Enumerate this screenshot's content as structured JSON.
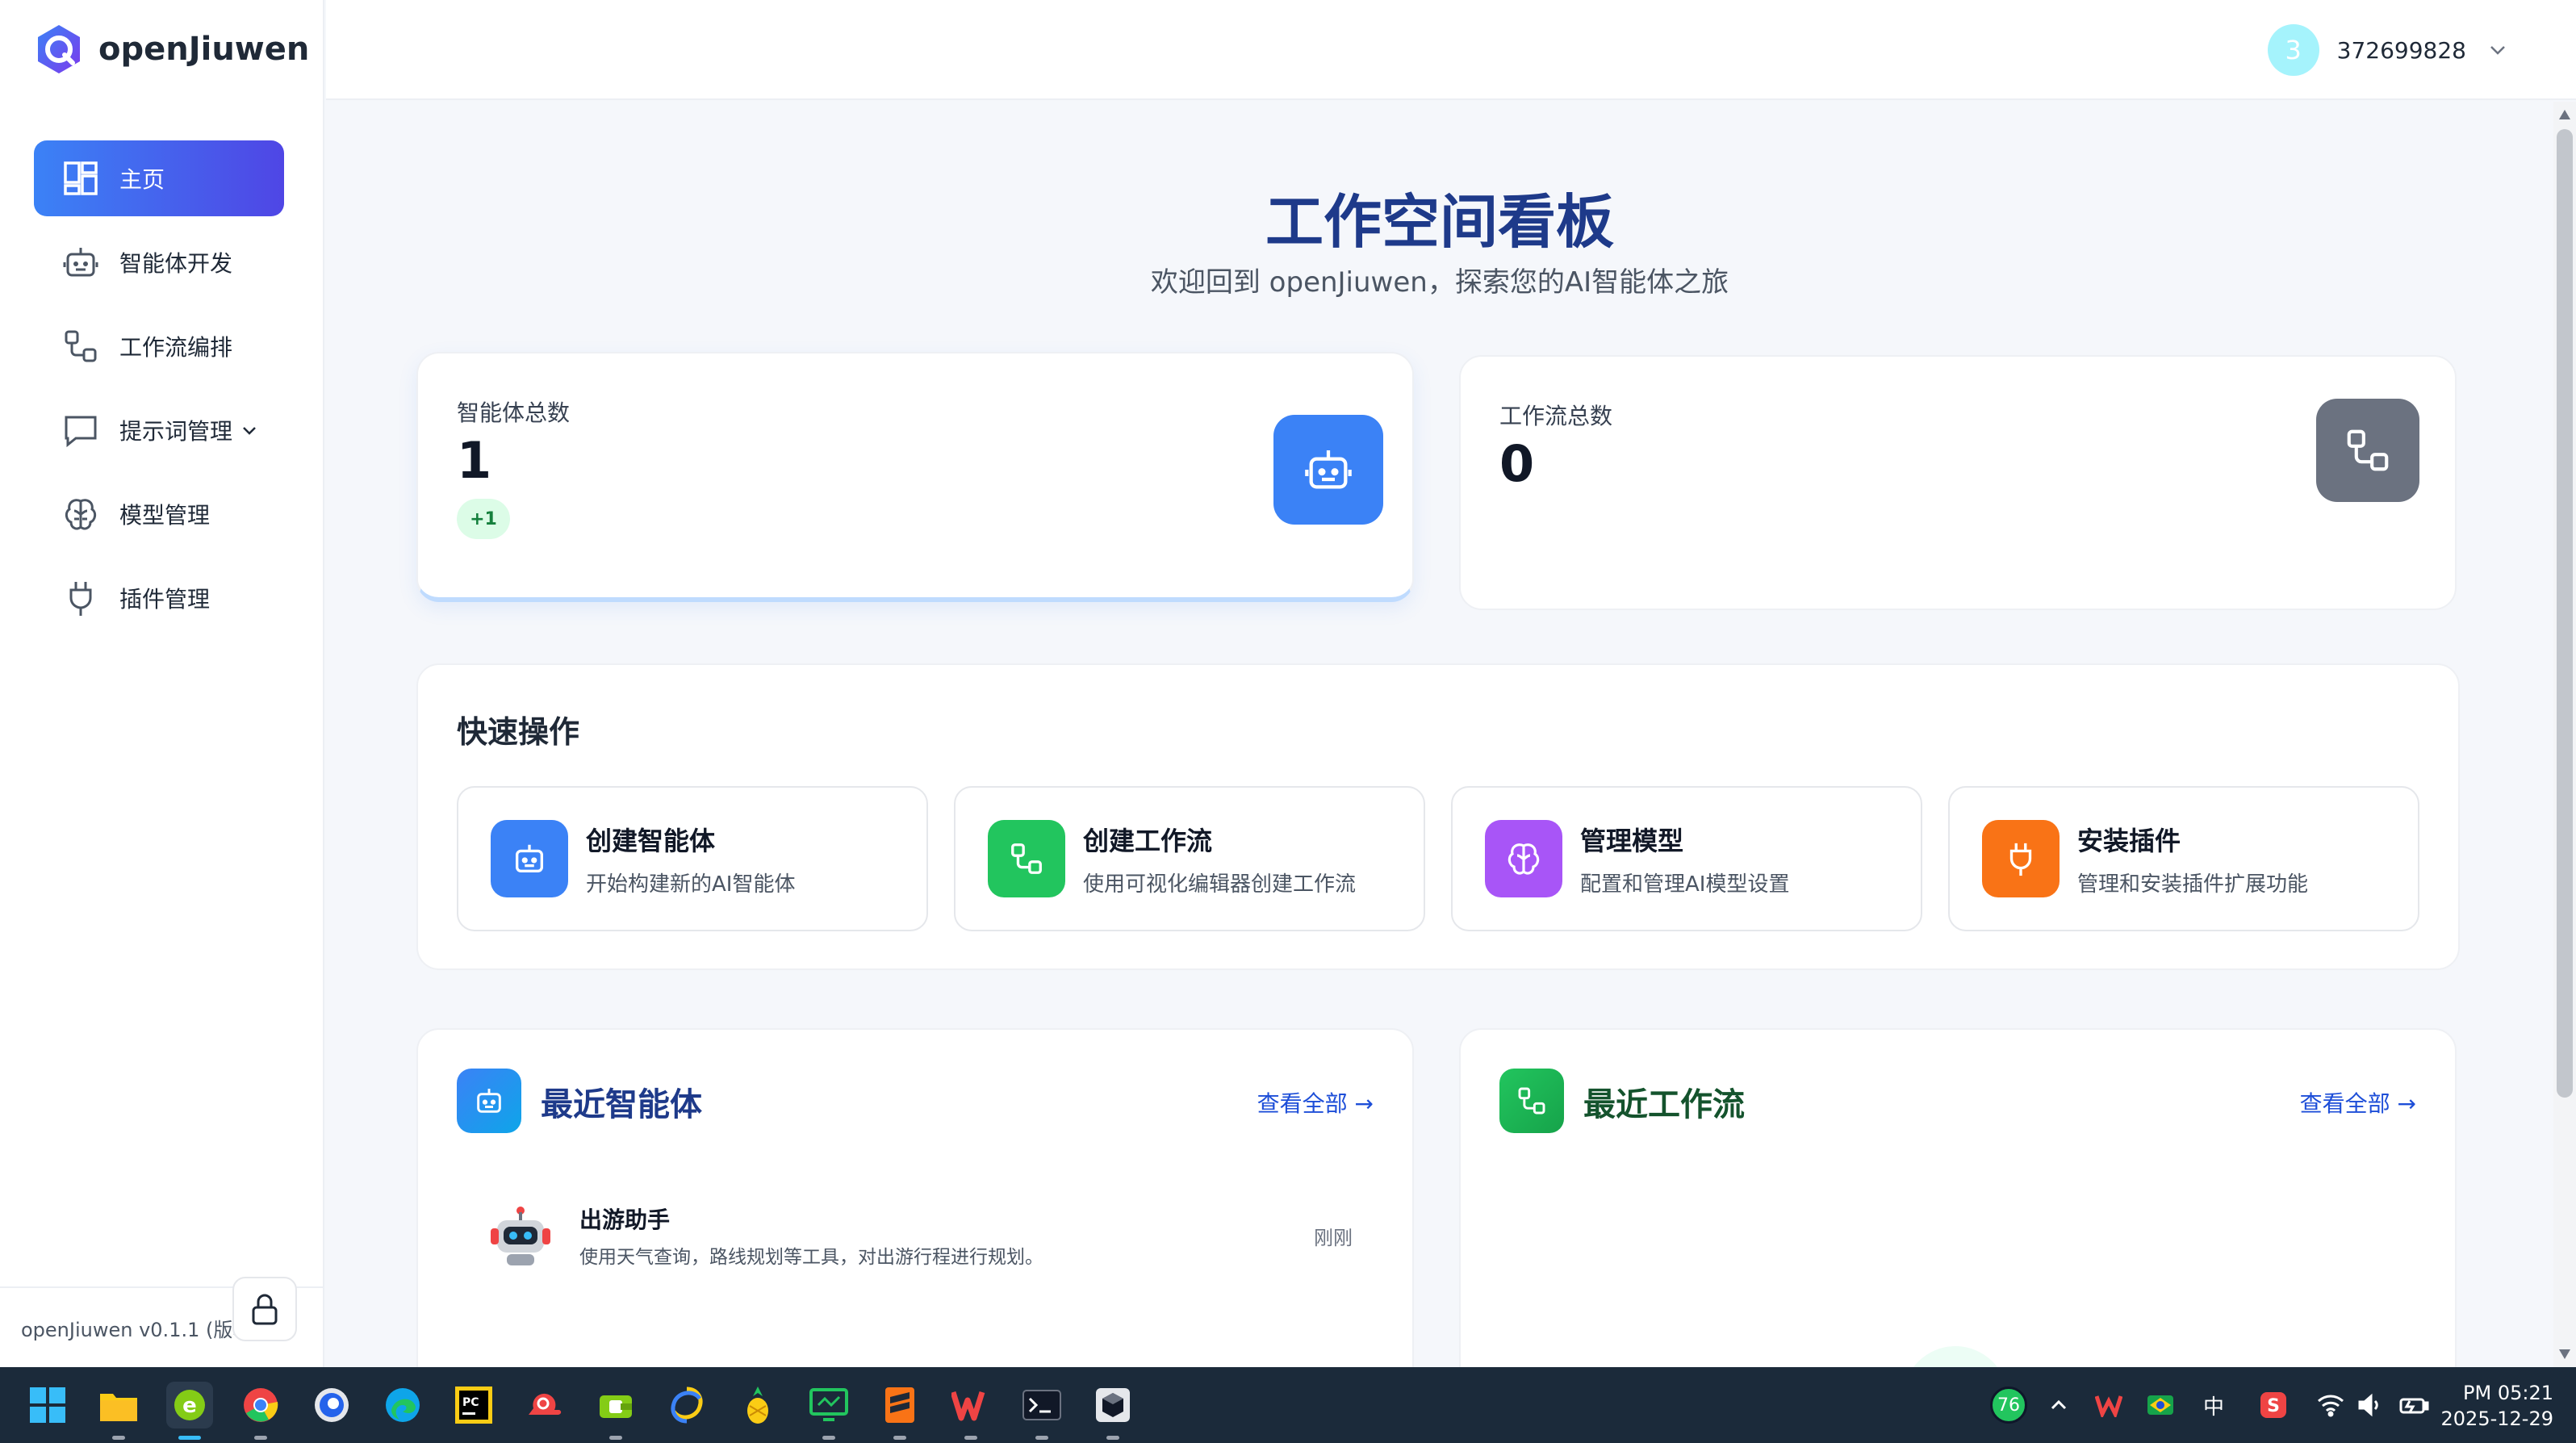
{
  "brand": {
    "name": "openJiuwen"
  },
  "nav": [
    {
      "label": "主页",
      "icon": "dashboard-icon",
      "active": true
    },
    {
      "label": "智能体开发",
      "icon": "robot-icon"
    },
    {
      "label": "工作流编排",
      "icon": "workflow-icon"
    },
    {
      "label": "提示词管理",
      "icon": "chat-icon",
      "has_submenu": true
    },
    {
      "label": "模型管理",
      "icon": "brain-icon"
    },
    {
      "label": "插件管理",
      "icon": "plug-icon"
    }
  ],
  "footer": {
    "version": "openJiuwen v0.1.1 (版本"
  },
  "header": {
    "avatar_initial": "3",
    "username": "372699828"
  },
  "page": {
    "title": "工作空间看板",
    "subtitle": "欢迎回到 openJiuwen，探索您的AI智能体之旅"
  },
  "stats": [
    {
      "label": "智能体总数",
      "value": "1",
      "badge": "+1",
      "icon": "robot-icon",
      "color": "#3b82f6"
    },
    {
      "label": "工作流总数",
      "value": "0",
      "icon": "workflow-icon",
      "color": "#6b7280"
    }
  ],
  "quick": {
    "title": "快速操作",
    "actions": [
      {
        "title": "创建智能体",
        "desc": "开始构建新的AI智能体",
        "icon": "robot-icon",
        "color": "#3b82f6"
      },
      {
        "title": "创建工作流",
        "desc": "使用可视化编辑器创建工作流",
        "icon": "workflow-icon",
        "color": "#22c55e"
      },
      {
        "title": "管理模型",
        "desc": "配置和管理AI模型设置",
        "icon": "brain-icon",
        "color": "#a855f7"
      },
      {
        "title": "安装插件",
        "desc": "管理和安装插件扩展功能",
        "icon": "plug-icon",
        "color": "#f97316"
      }
    ]
  },
  "recent_agents": {
    "title": "最近智能体",
    "view_all": "查看全部 →",
    "items": [
      {
        "name": "出游助手",
        "desc": "使用天气查询，路线规划等工具，对出游行程进行规划。",
        "time": "刚刚"
      }
    ]
  },
  "recent_flows": {
    "title": "最近工作流",
    "view_all": "查看全部 →"
  },
  "taskbar": {
    "tray": {
      "badge": "76",
      "ime": "中"
    },
    "clock": {
      "time": "PM 05:21",
      "date": "2025-12-29"
    }
  },
  "colors": {
    "accent": "#3b82f6",
    "title": "#1e3a8a",
    "green": "#22c55e"
  }
}
